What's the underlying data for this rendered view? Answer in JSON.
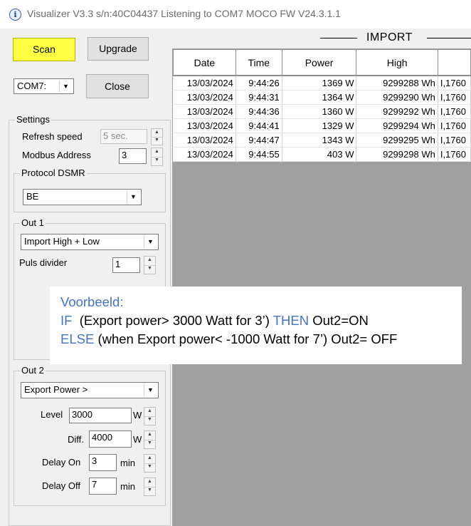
{
  "window": {
    "title": "Visualizer V3.3 s/n:40C04437 Listening to COM7 MOCO FW V24.3.1.1"
  },
  "buttons": {
    "scan": "Scan",
    "upgrade": "Upgrade",
    "close": "Close"
  },
  "port": {
    "selected": "COM7:"
  },
  "settings": {
    "label": "Settings",
    "refresh_label": "Refresh speed",
    "refresh_value": "5 sec.",
    "modbus_label": "Modbus Address",
    "modbus_value": "3",
    "protocol_label": "Protocol DSMR",
    "protocol_value": "BE"
  },
  "out1": {
    "label": "Out 1",
    "mode": "Import High + Low",
    "puls_label": "Puls divider",
    "puls_value": "1"
  },
  "out2": {
    "label": "Out 2",
    "mode": "Export Power >",
    "level_label": "Level",
    "level_value": "3000",
    "level_unit": "W",
    "diff_label": "Diff.",
    "diff_value": "4000",
    "diff_unit": "W",
    "delay_on_label": "Delay On",
    "delay_on_value": "3",
    "delay_on_unit": "min",
    "delay_off_label": "Delay Off",
    "delay_off_value": "7",
    "delay_off_unit": "min"
  },
  "import": {
    "title": "IMPORT",
    "columns": [
      "Date",
      "Time",
      "Power",
      "High",
      ""
    ],
    "rows": [
      [
        "13/03/2024",
        "9:44:26",
        "1369 W",
        "9299288 Wh",
        "I,1760"
      ],
      [
        "13/03/2024",
        "9:44:31",
        "1364 W",
        "9299290 Wh",
        "I,1760"
      ],
      [
        "13/03/2024",
        "9:44:36",
        "1360 W",
        "9299292 Wh",
        "I,1760"
      ],
      [
        "13/03/2024",
        "9:44:41",
        "1329 W",
        "9299294 Wh",
        "I,1760"
      ],
      [
        "13/03/2024",
        "9:44:47",
        "1343 W",
        "9299295 Wh",
        "I,1760"
      ],
      [
        "13/03/2024",
        "9:44:55",
        "403 W",
        "9299298 Wh",
        "I,1760"
      ]
    ]
  },
  "note": {
    "heading": "Voorbeeld:",
    "if_kw": "IF",
    "if_text": "  (Export power> 3000 Watt for 3’)",
    "then_kw": "THEN",
    "then_text": " Out2=ON",
    "else_kw": "ELSE",
    "else_text": " (when Export power< -1000 Watt for 7’) Out2= OFF"
  },
  "colors": {
    "scan_button": "#ffff44",
    "note_blue": "#4472c4",
    "grid_background": "#a0a0a0"
  }
}
